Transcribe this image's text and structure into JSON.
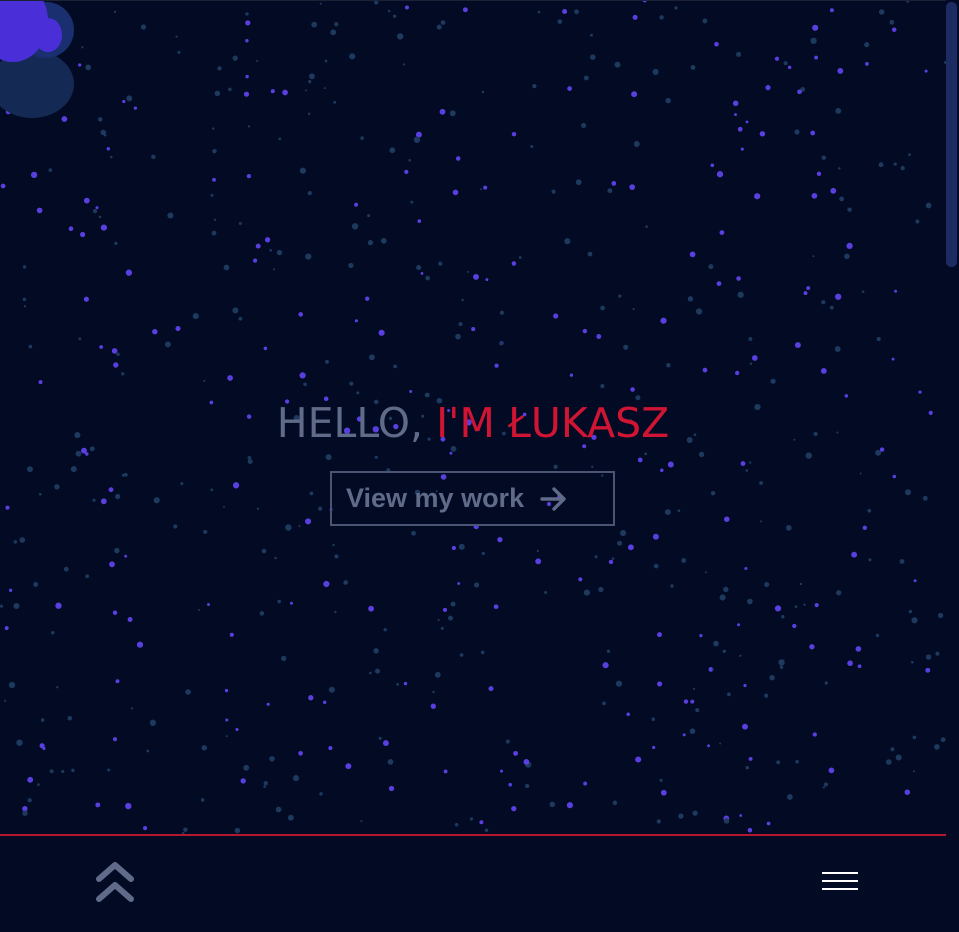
{
  "hero": {
    "greeting": "HELLO,",
    "name": "I'M ŁUKASZ",
    "cta_label": "View my work"
  },
  "icons": {
    "cta": "arrow-right-icon",
    "up": "double-chevron-up-icon",
    "menu": "hamburger-menu-icon"
  },
  "colors": {
    "background": "#020a24",
    "accent": "#d01534",
    "muted_text": "#5f6b88",
    "star_purple": "#5a3fe0",
    "star_blue": "#1d3a5e"
  }
}
